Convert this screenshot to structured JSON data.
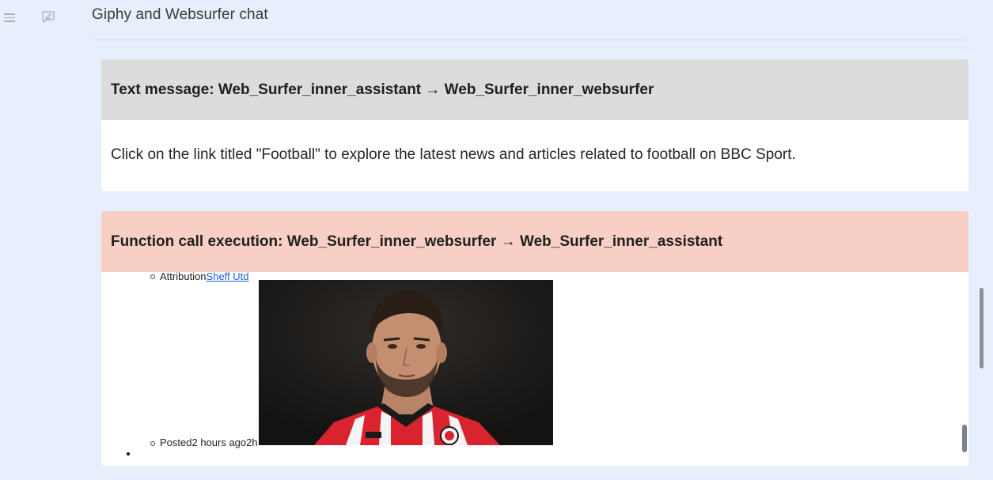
{
  "header": {
    "title": "Giphy and Websurfer chat"
  },
  "icons": {
    "menu": "hamburger-menu-icon",
    "new_chat": "new-chat-icon"
  },
  "messages": [
    {
      "header": "Text message: Web_Surfer_inner_assistant → Web_Surfer_inner_websurfer",
      "header_color": "#dcdcdc",
      "body": "Click on the link titled \"Football\" to explore the latest news and articles related to football on BBC Sport."
    },
    {
      "header": "Function call execution: Web_Surfer_inner_websurfer → Web_Surfer_inner_assistant",
      "header_color": "#f8cfc4",
      "attribution_label": "Attribution",
      "attribution_link": "Sheff Utd",
      "posted_label": "Posted",
      "posted_value": "2 hours ago",
      "posted_short": "2h"
    }
  ],
  "colors": {
    "background": "#e8effc",
    "link": "#1a5fd6"
  }
}
